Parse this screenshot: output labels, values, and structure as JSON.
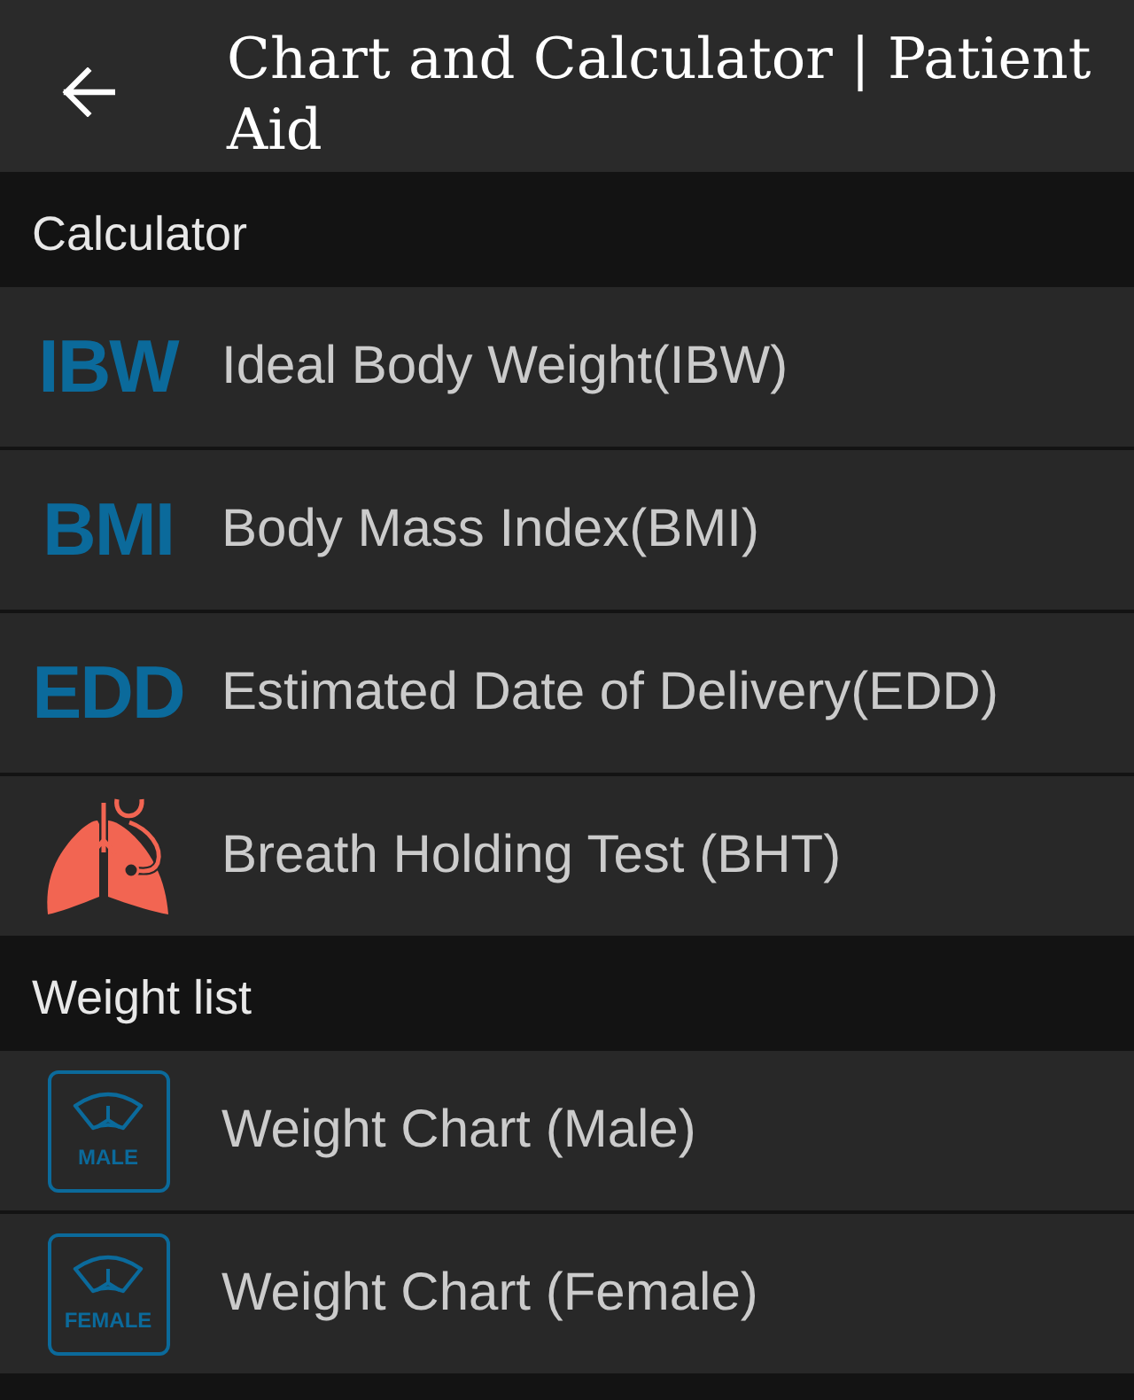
{
  "app_bar": {
    "title": "Chart and Calculator | Patient Aid"
  },
  "sections": [
    {
      "header": "Calculator",
      "items": [
        {
          "label": "Ideal Body Weight(IBW)",
          "kind": "text-logo",
          "badge": "IBW"
        },
        {
          "label": "Body Mass Index(BMI)",
          "kind": "text-logo",
          "badge": "BMI"
        },
        {
          "label": "Estimated Date of Delivery(EDD)",
          "kind": "text-logo",
          "badge": "EDD"
        },
        {
          "label": "Breath Holding Test (BHT)",
          "kind": "lungs"
        }
      ]
    },
    {
      "header": "Weight list",
      "items": [
        {
          "label": "Weight Chart (Male)",
          "kind": "scale",
          "badge": "MALE"
        },
        {
          "label": "Weight Chart (Female)",
          "kind": "scale",
          "badge": "FEMALE"
        }
      ]
    }
  ]
}
